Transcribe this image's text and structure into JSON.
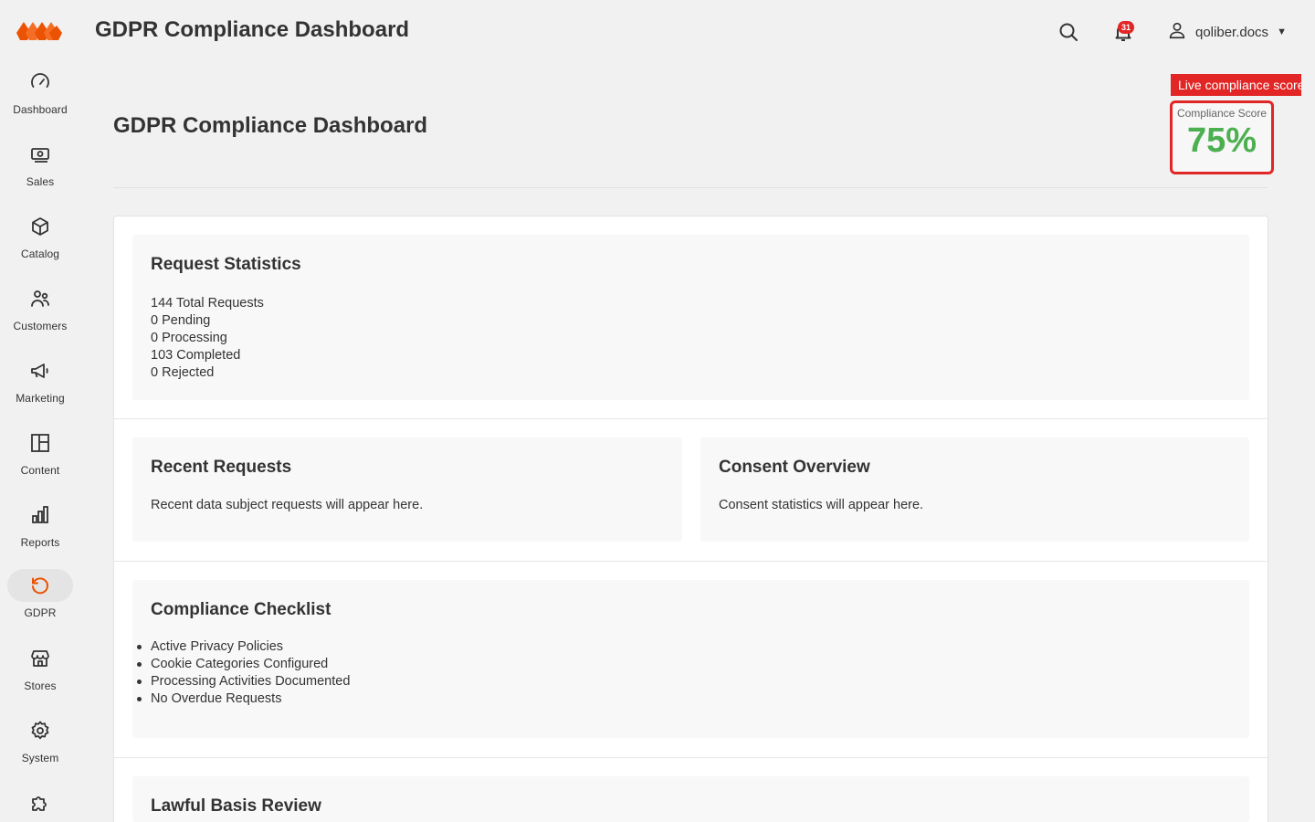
{
  "app": {
    "title": "GDPR Compliance Dashboard",
    "accent": "#eb5202"
  },
  "header": {
    "notification_count": "31",
    "username": "qoliber.docs",
    "caret": "▼",
    "icons": [
      "search-icon",
      "bell-icon",
      "user-icon"
    ]
  },
  "sidebar": {
    "items": [
      {
        "label": "Dashboard",
        "icon": "gauge-icon"
      },
      {
        "label": "Sales",
        "icon": "cash-icon"
      },
      {
        "label": "Catalog",
        "icon": "box-icon"
      },
      {
        "label": "Customers",
        "icon": "people-icon"
      },
      {
        "label": "Marketing",
        "icon": "megaphone-icon"
      },
      {
        "label": "Content",
        "icon": "layout-icon"
      },
      {
        "label": "Reports",
        "icon": "bar-chart-icon"
      },
      {
        "label": "GDPR",
        "icon": "refresh-icon",
        "active": true
      },
      {
        "label": "Stores",
        "icon": "store-icon"
      },
      {
        "label": "System",
        "icon": "gear-icon"
      },
      {
        "label": "",
        "icon": "puzzle-icon"
      }
    ]
  },
  "page": {
    "title": "GDPR Compliance Dashboard",
    "live_label": "Live compliance score",
    "score_caption": "Compliance Score",
    "score_value": "75%",
    "score_color": "#4caf50"
  },
  "request_statistics": {
    "title": "Request Statistics",
    "lines": [
      "144 Total Requests",
      "0 Pending",
      "0 Processing",
      "103 Completed",
      "0 Rejected"
    ]
  },
  "recent_requests": {
    "title": "Recent Requests",
    "text": "Recent data subject requests will appear here."
  },
  "consent_overview": {
    "title": "Consent Overview",
    "text": "Consent statistics will appear here."
  },
  "compliance_checklist": {
    "title": "Compliance Checklist",
    "items": [
      "Active Privacy Policies",
      "Cookie Categories Configured",
      "Processing Activities Documented",
      "No Overdue Requests"
    ]
  },
  "lawful_basis": {
    "title": "Lawful Basis Review"
  }
}
